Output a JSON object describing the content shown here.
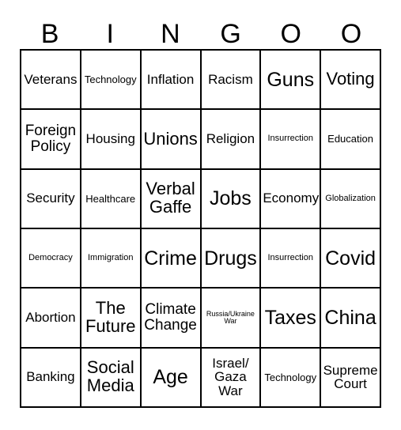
{
  "card": {
    "title": "Bingo Card",
    "background_color": "#ffffff",
    "border_color": "#000000",
    "text_color": "#000000",
    "columns": 6,
    "rows": 6,
    "header": {
      "letters": [
        "B",
        "I",
        "N",
        "G",
        "O",
        "O"
      ]
    },
    "cells": [
      {
        "text": "Veterans",
        "size": "md"
      },
      {
        "text": "Technology",
        "size": "sm"
      },
      {
        "text": "Inflation",
        "size": "md"
      },
      {
        "text": "Racism",
        "size": "md"
      },
      {
        "text": "Guns",
        "size": "xxl"
      },
      {
        "text": "Voting",
        "size": "xl"
      },
      {
        "text": "Foreign\nPolicy",
        "size": "lg"
      },
      {
        "text": "Housing",
        "size": "md"
      },
      {
        "text": "Unions",
        "size": "xl"
      },
      {
        "text": "Religion",
        "size": "md"
      },
      {
        "text": "Insurrection",
        "size": "xs"
      },
      {
        "text": "Education",
        "size": "sm"
      },
      {
        "text": "Security",
        "size": "md"
      },
      {
        "text": "Healthcare",
        "size": "sm"
      },
      {
        "text": "Verbal\nGaffe",
        "size": "xl"
      },
      {
        "text": "Jobs",
        "size": "xxl"
      },
      {
        "text": "Economy",
        "size": "md"
      },
      {
        "text": "Globalization",
        "size": "xs"
      },
      {
        "text": "Democracy",
        "size": "xs"
      },
      {
        "text": "Immigration",
        "size": "xs"
      },
      {
        "text": "Crime",
        "size": "xxl"
      },
      {
        "text": "Drugs",
        "size": "xxl"
      },
      {
        "text": "Insurrection",
        "size": "xs"
      },
      {
        "text": "Covid",
        "size": "xxl"
      },
      {
        "text": "Abortion",
        "size": "md"
      },
      {
        "text": "The\nFuture",
        "size": "xl"
      },
      {
        "text": "Climate\nChange",
        "size": "lg"
      },
      {
        "text": "Russia/Ukraine\nWar",
        "size": "xxs"
      },
      {
        "text": "Taxes",
        "size": "xxl"
      },
      {
        "text": "China",
        "size": "xxl"
      },
      {
        "text": "Banking",
        "size": "md"
      },
      {
        "text": "Social\nMedia",
        "size": "xl"
      },
      {
        "text": "Age",
        "size": "xxl"
      },
      {
        "text": "Israel/\nGaza\nWar",
        "size": "md"
      },
      {
        "text": "Technology",
        "size": "sm"
      },
      {
        "text": "Supreme\nCourt",
        "size": "md"
      }
    ]
  }
}
